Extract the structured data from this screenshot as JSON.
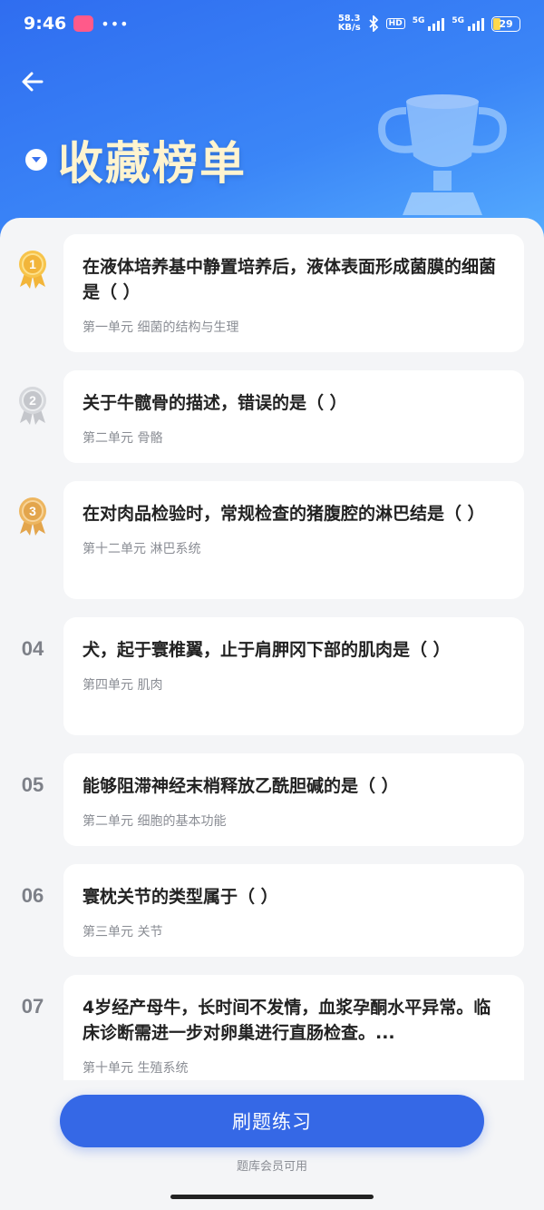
{
  "status": {
    "time": "9:46",
    "speed": "58.3",
    "speed_unit": "KB/s",
    "hd": "HD",
    "net1": "5G",
    "net2": "5G",
    "battery": "29"
  },
  "header": {
    "title": "收藏榜单"
  },
  "items": [
    {
      "rank": "01",
      "question": "在液体培养基中静置培养后，液体表面形成菌膜的细菌是（ ）",
      "unit": "第一单元 细菌的结构与生理"
    },
    {
      "rank": "02",
      "question": "关于牛髋骨的描述，错误的是（ ）",
      "unit": "第二单元 骨骼"
    },
    {
      "rank": "03",
      "question": "在对肉品检验时，常规检查的猪腹腔的淋巴结是（ ）",
      "unit": "第十二单元 淋巴系统"
    },
    {
      "rank": "04",
      "question": "犬，起于寰椎翼，止于肩胛冈下部的肌肉是（ ）",
      "unit": "第四单元 肌肉"
    },
    {
      "rank": "05",
      "question": "能够阻滞神经末梢释放乙酰胆碱的是（ ）",
      "unit": "第二单元 细胞的基本功能"
    },
    {
      "rank": "06",
      "question": "寰枕关节的类型属于（ ）",
      "unit": "第三单元 关节"
    },
    {
      "rank": "07",
      "question": "4岁经产母牛，长时间不发情，血浆孕酮水平异常。临床诊断需进一步对卵巢进行直肠检查。...",
      "unit": "第十单元 生殖系统"
    }
  ],
  "footer": {
    "cta_label": "刷题练习",
    "cta_note": "题库会员可用"
  },
  "colors": {
    "gold": "#f2b53a",
    "silver": "#c4c6cb",
    "bronze": "#e3a54c",
    "accent": "#3568e6"
  }
}
